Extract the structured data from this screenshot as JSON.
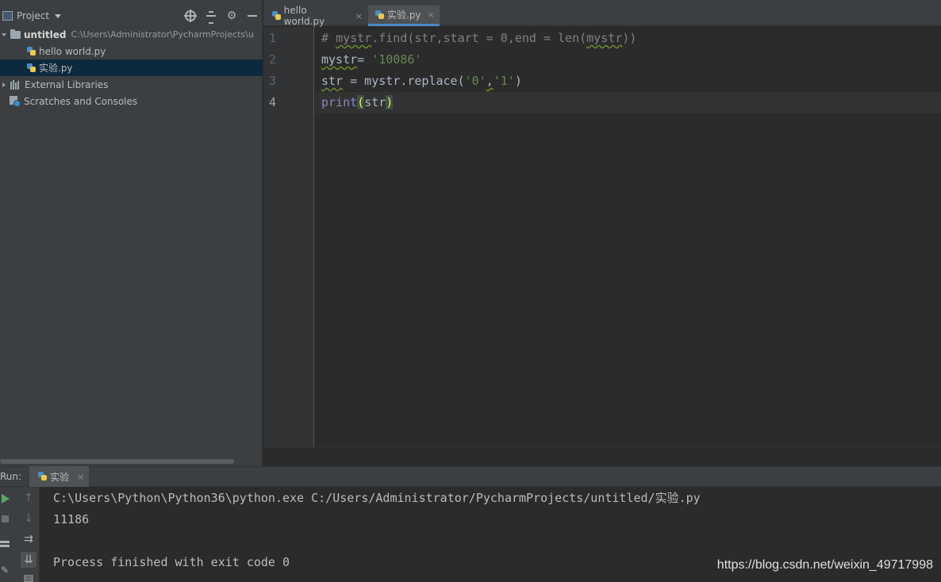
{
  "project_panel": {
    "title": "Project",
    "tree": [
      {
        "label": "untitled",
        "path": "C:\\Users\\Administrator\\PycharmProjects\\u"
      },
      {
        "label": "hello world.py"
      },
      {
        "label": "实验.py"
      },
      {
        "label": "External Libraries"
      },
      {
        "label": "Scratches and Consoles"
      }
    ]
  },
  "editor": {
    "tabs": [
      {
        "label": "hello world.py",
        "close": "×"
      },
      {
        "label": "实验.py",
        "close": "×"
      }
    ],
    "line_numbers": [
      "1",
      "2",
      "3",
      "4"
    ],
    "code": {
      "l1_comment": "# ",
      "l1_mystr": "mystr",
      "l1_rest": ".find(str,start = 0,end = len(",
      "l1_mystr2": "mystr",
      "l1_end": "))",
      "l2_mystr": "mystr",
      "l2_eq": "= ",
      "l2_str": "'10086'",
      "l3_str": "str",
      "l3_mid": " = mystr.replace(",
      "l3_s1": "'0'",
      "l3_comma": ",",
      "l3_s2": "'1'",
      "l3_end": ")",
      "l4_print": "print",
      "l4_open": "(",
      "l4_arg": "str",
      "l4_close": ")"
    }
  },
  "run_panel": {
    "label": "Run:",
    "tab_label": "实验",
    "tab_close": "×",
    "console": [
      "C:\\Users\\Python\\Python36\\python.exe C:/Users/Administrator/PycharmProjects/untitled/实验.py",
      "11186",
      "",
      "Process finished with exit code 0"
    ]
  },
  "watermark": "https://blog.csdn.net/weixin_49717998"
}
